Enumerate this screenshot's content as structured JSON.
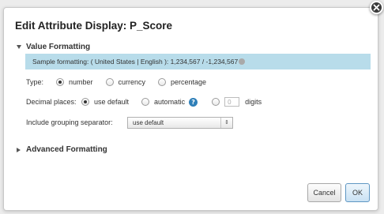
{
  "dialog": {
    "title": "Edit Attribute Display: P_Score",
    "close_icon": "close-icon"
  },
  "value_formatting": {
    "header": "Value Formatting",
    "sample": "Sample formatting: ( United States | English ): 1,234,567 / -1,234,567",
    "type": {
      "label": "Type:",
      "options": [
        "number",
        "currency",
        "percentage"
      ],
      "selected": "number"
    },
    "decimal_places": {
      "label": "Decimal places:",
      "options": [
        "use default",
        "automatic"
      ],
      "selected": "use default",
      "digits_value": "0",
      "digits_label": "digits"
    },
    "grouping": {
      "label": "Include grouping separator:",
      "value": "use default"
    }
  },
  "advanced_formatting": {
    "header": "Advanced Formatting"
  },
  "buttons": {
    "cancel": "Cancel",
    "ok": "OK"
  },
  "icons": {
    "help": "?",
    "select_arrow": "⇕"
  },
  "colors": {
    "sample_bar": "#b8dcea",
    "help_icon": "#2f7fb8",
    "ok_border": "#5f97c3"
  }
}
